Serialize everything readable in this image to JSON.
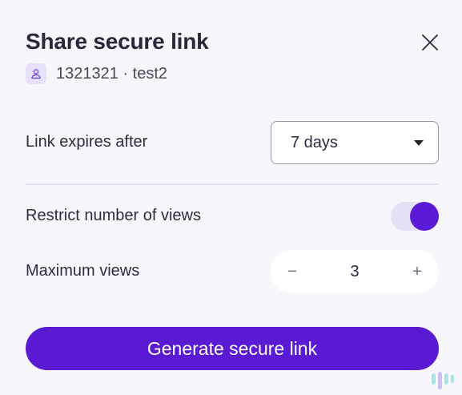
{
  "dialog": {
    "title": "Share secure link",
    "subtitle": "1321321 · test2",
    "close_icon": "close-icon",
    "user_icon": "user-icon"
  },
  "expiry": {
    "label": "Link expires after",
    "selected": "7 days"
  },
  "restrict_views": {
    "label": "Restrict number of views",
    "enabled": true
  },
  "max_views": {
    "label": "Maximum views",
    "value": "3",
    "decrement": "−",
    "increment": "+"
  },
  "actions": {
    "generate_label": "Generate secure link"
  },
  "colors": {
    "accent": "#5a1ad3",
    "toggle_track": "#e5e0f6",
    "divider": "#e6e1f5",
    "background": "#f7f6fb"
  }
}
